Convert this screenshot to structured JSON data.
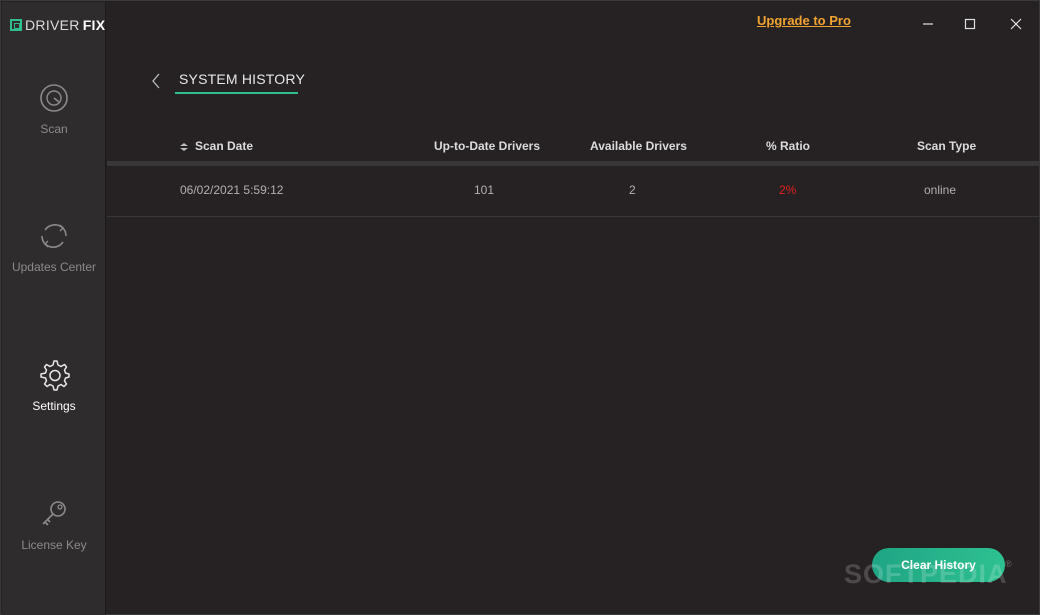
{
  "app": {
    "logo_light": "DRIVER",
    "logo_bold": "FIX",
    "upgrade_label": "Upgrade to Pro",
    "accent_color": "#2fbf8f",
    "upgrade_color": "#f0a330"
  },
  "sidebar": {
    "items": [
      {
        "label": "Scan",
        "icon": "scan-gauge-icon"
      },
      {
        "label": "Updates Center",
        "icon": "refresh-cycle-icon"
      },
      {
        "label": "Settings",
        "icon": "gear-icon",
        "active": true
      },
      {
        "label": "License Key",
        "icon": "key-icon"
      }
    ]
  },
  "header": {
    "title": "SYSTEM HISTORY"
  },
  "table": {
    "columns": [
      "Scan Date",
      "Up-to-Date Drivers",
      "Available Drivers",
      "% Ratio",
      "Scan Type"
    ],
    "rows": [
      {
        "scan_date": "06/02/2021 5:59:12",
        "up_to_date": "101",
        "available": "2",
        "ratio": "2%",
        "scan_type": "online"
      }
    ]
  },
  "actions": {
    "clear_history": "Clear History"
  },
  "watermark": {
    "text": "SOFTPEDIA",
    "mark": "®"
  }
}
